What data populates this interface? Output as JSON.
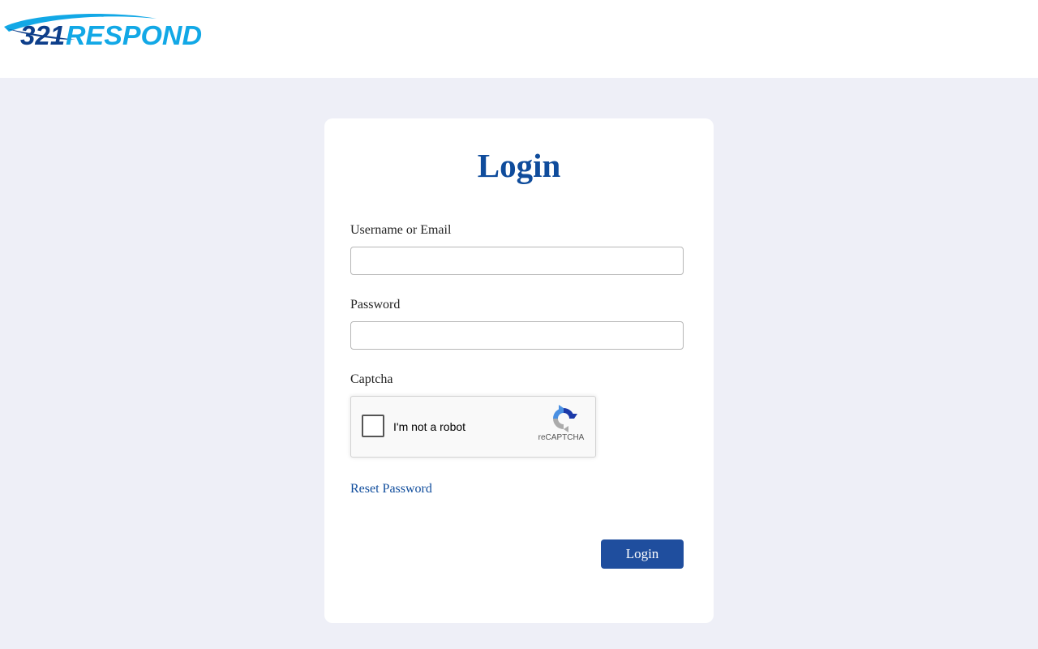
{
  "header": {
    "logo_text_prefix": "321",
    "logo_text_suffix": "RESPOND"
  },
  "login": {
    "title": "Login",
    "username_label": "Username or Email",
    "username_value": "",
    "password_label": "Password",
    "password_value": "",
    "captcha_label": "Captcha",
    "recaptcha_text": "I'm not a robot",
    "recaptcha_brand": "reCAPTCHA",
    "reset_password_link": "Reset Password",
    "login_button": "Login"
  },
  "colors": {
    "page_background": "#eeeff7",
    "accent_blue": "#0f4c9c",
    "button_blue": "#1f4e9e",
    "logo_light_blue": "#12a8e6",
    "logo_dark_blue": "#0d3e8a"
  },
  "icons": {
    "recaptcha_icon": "recaptcha-arrows-icon"
  }
}
